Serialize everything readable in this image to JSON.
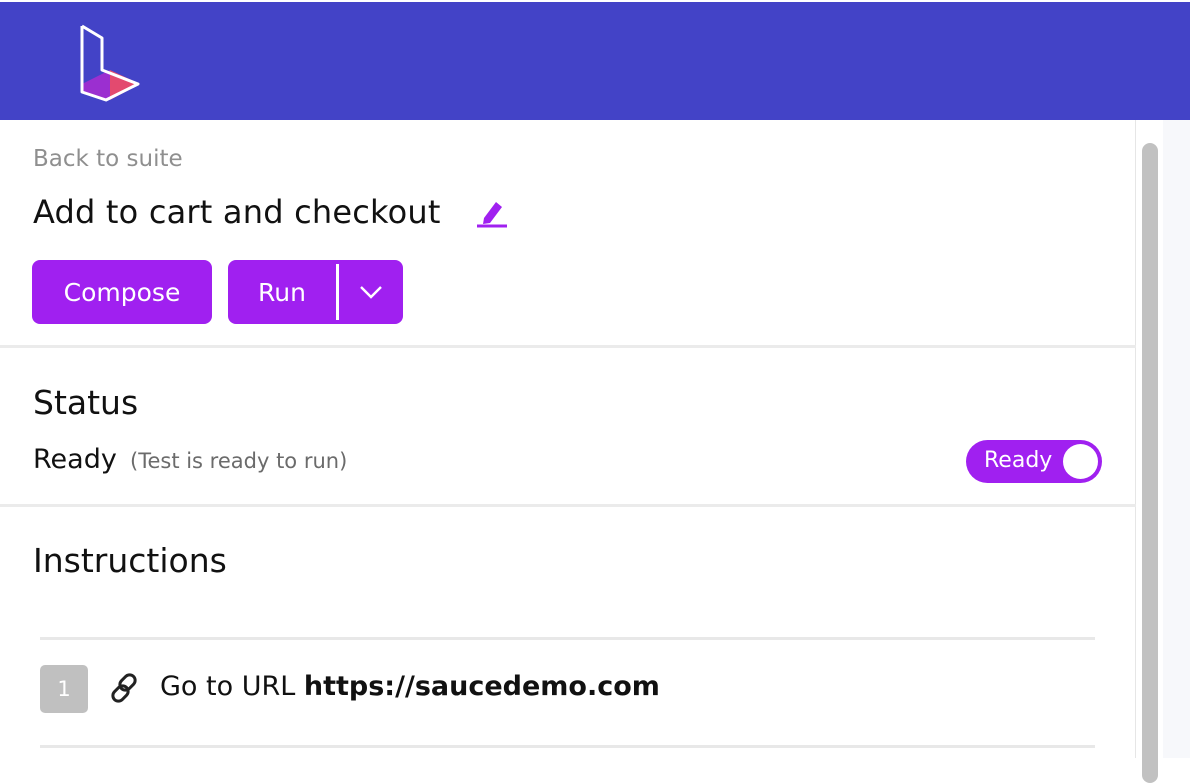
{
  "header": {
    "logo_icon": "app-logo-icon",
    "background_color": "#4343c7"
  },
  "test": {
    "back_label": "Back to suite",
    "title": "Add to cart and checkout",
    "edit_icon": "pencil-icon",
    "actions": {
      "compose_label": "Compose",
      "run_label": "Run",
      "run_menu_icon": "chevron-down-icon"
    }
  },
  "status": {
    "heading": "Status",
    "value": "Ready",
    "description": "(Test is ready to run)",
    "toggle_label": "Ready",
    "toggle_on": true
  },
  "instructions": {
    "heading": "Instructions",
    "steps": [
      {
        "number": "1",
        "icon": "link-icon",
        "action": "Go to URL",
        "target": "https://saucedemo.com"
      }
    ]
  },
  "colors": {
    "accent": "#a020f0",
    "muted_text": "#8f8f8f"
  }
}
